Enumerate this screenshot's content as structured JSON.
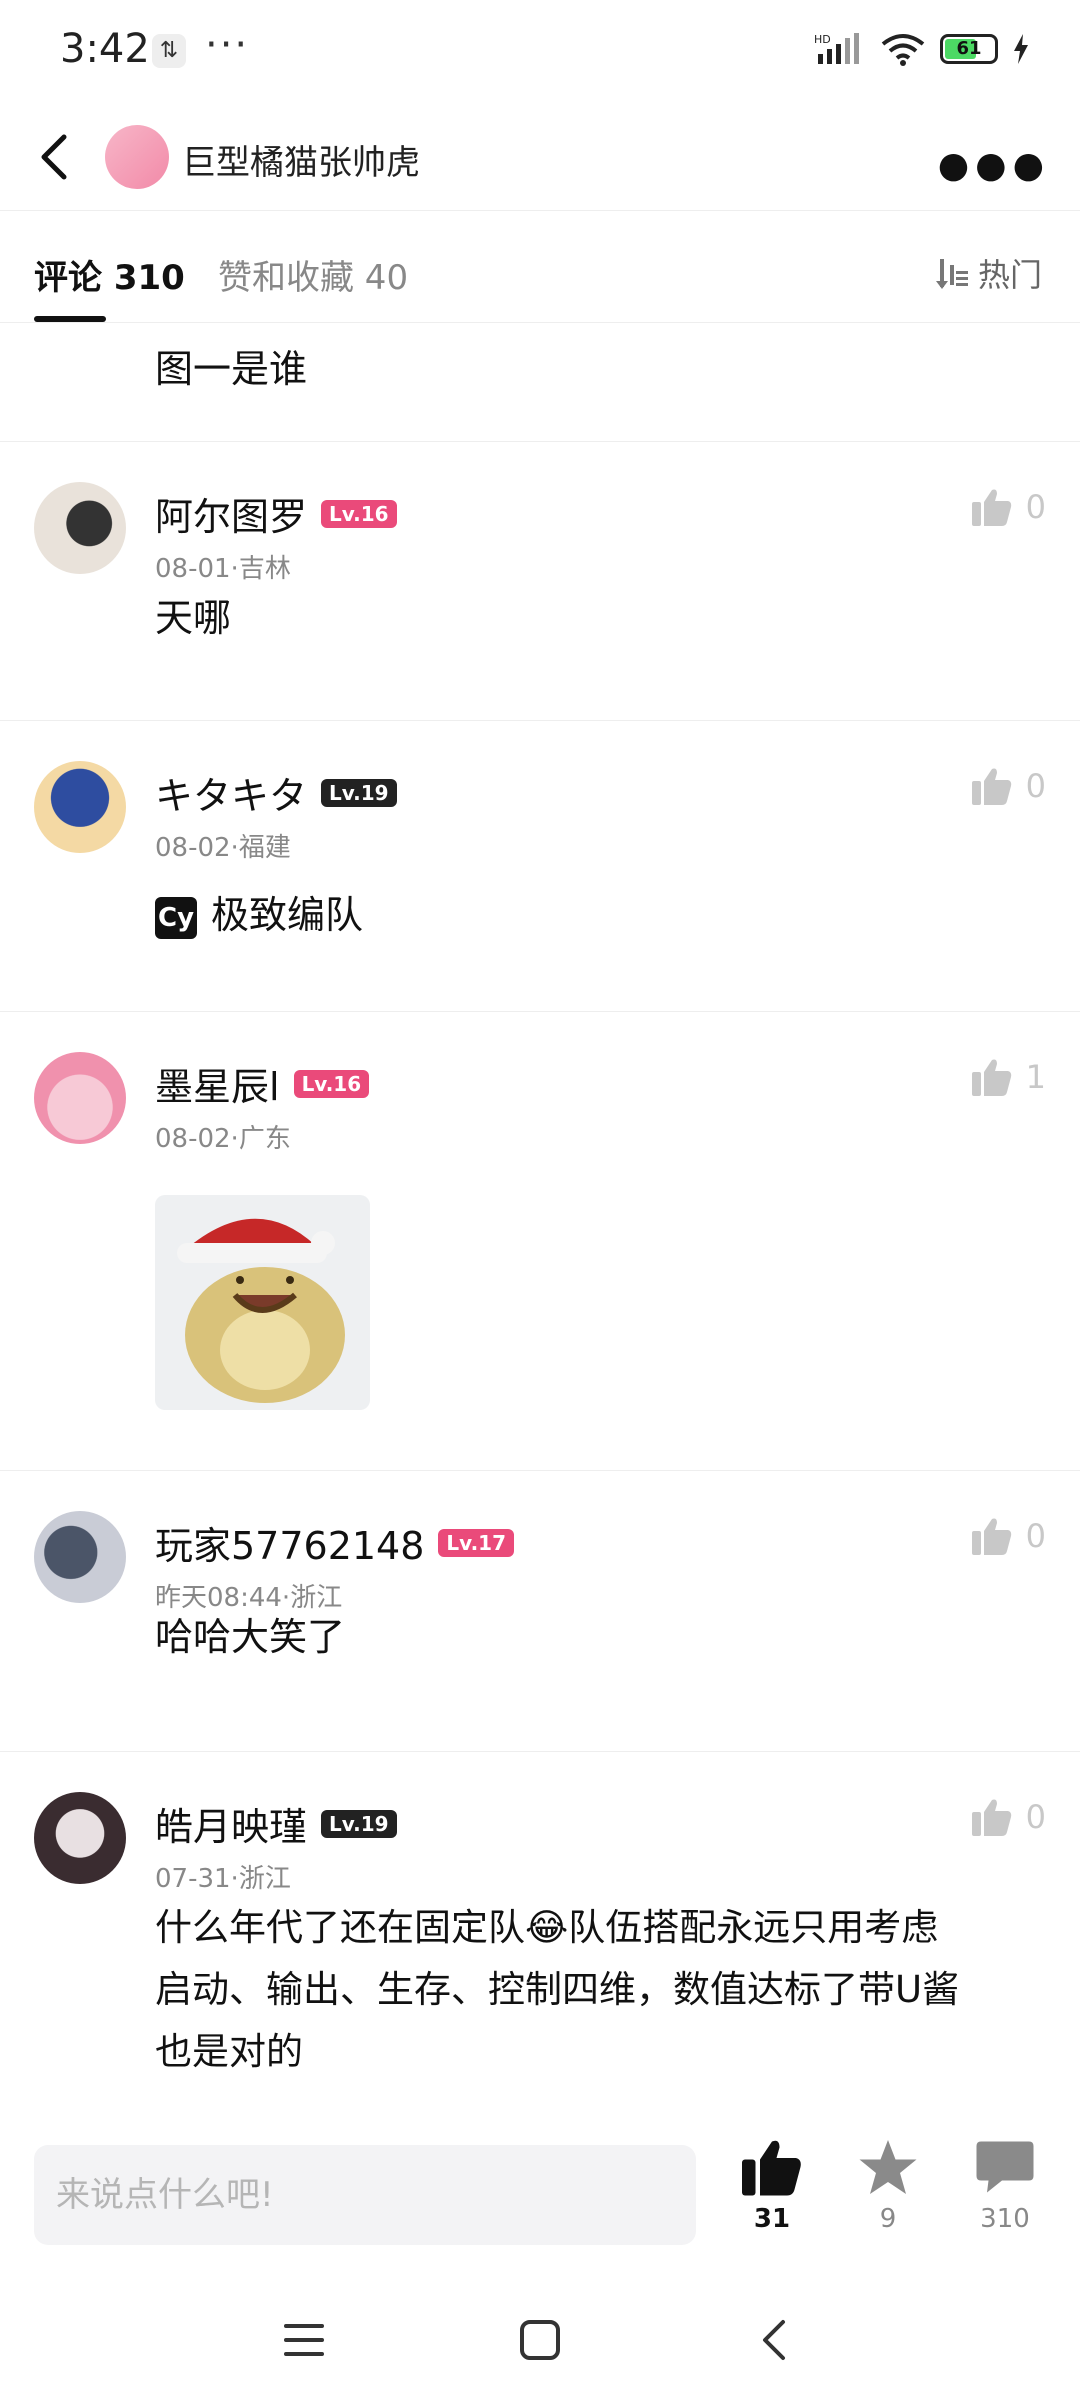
{
  "status_bar": {
    "time": "3:42",
    "battery": "61"
  },
  "header": {
    "title": "巨型橘猫张帅虎"
  },
  "tabs": [
    {
      "label": "评论 310"
    },
    {
      "label": "赞和收藏 40"
    }
  ],
  "sort_label": "热门",
  "partial_comment": {
    "text": "图一是谁"
  },
  "comments": [
    {
      "name": "阿尔图罗",
      "level": "Lv.16",
      "meta": "08-01·吉林",
      "likes": "0",
      "text": "天哪"
    },
    {
      "name": "キタキタ",
      "level": "Lv.19",
      "meta": "08-02·福建",
      "likes": "0",
      "badge": "Cy",
      "text": "极致编队"
    },
    {
      "name": "墨星辰l",
      "level": "Lv.16",
      "meta": "08-02·广东",
      "likes": "1"
    },
    {
      "name": "玩家57762148",
      "level": "Lv.17",
      "meta": "昨天08:44·浙江",
      "likes": "0",
      "text": "哈哈大笑了"
    },
    {
      "name": "皓月映瑾",
      "level": "Lv.19",
      "meta": "07-31·浙江",
      "likes": "0",
      "text_lines": [
        "什么年代了还在固定队😂队伍搭配永远只用考虑",
        "启动、输出、生存、控制四维，数值达标了带U酱",
        "也是对的"
      ]
    }
  ],
  "bottom_bar": {
    "input_placeholder": "来说点什么吧!",
    "like_count": "31",
    "star_count": "9",
    "comment_count": "310"
  },
  "colors": {
    "level_pink": "#ea4a7a",
    "level_black": "#222222"
  }
}
